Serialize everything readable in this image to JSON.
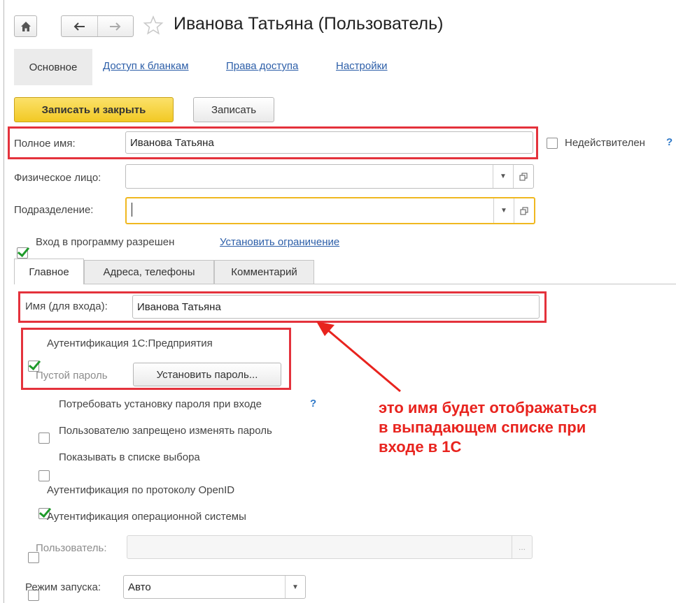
{
  "window": {
    "title": "Иванова Татьяна (Пользователь)",
    "icons": {
      "home": "home-icon",
      "back": "back-arrow-icon",
      "forward": "forward-arrow-icon",
      "favorite": "star-icon"
    }
  },
  "nav_tabs": [
    {
      "label": "Основное",
      "active": true
    },
    {
      "label": "Доступ к бланкам"
    },
    {
      "label": "Права доступа"
    },
    {
      "label": "Настройки"
    }
  ],
  "toolbar": {
    "save_close_label": "Записать и закрыть",
    "save_label": "Записать"
  },
  "form": {
    "full_name": {
      "label": "Полное имя:",
      "value": "Иванова Татьяна"
    },
    "invalid": {
      "label": "Недействителен",
      "checked": false,
      "help": "?"
    },
    "individual": {
      "label": "Физическое лицо:",
      "value": ""
    },
    "department": {
      "label": "Подразделение:",
      "value": ""
    },
    "login_allowed": {
      "label": "Вход в программу разрешен",
      "checked": true,
      "link": "Установить ограничение"
    }
  },
  "inner_tabs": [
    {
      "label": "Главное",
      "active": true
    },
    {
      "label": "Адреса, телефоны"
    },
    {
      "label": "Комментарий"
    }
  ],
  "main_tab": {
    "login_name": {
      "label": "Имя (для входа):",
      "value": "Иванова Татьяна"
    },
    "auth_1c": {
      "label": "Аутентификация 1С:Предприятия",
      "checked": true
    },
    "empty_password": "Пустой пароль",
    "set_password_button": "Установить пароль...",
    "require_password_change": {
      "label": "Потребовать установку пароля при входе",
      "checked": false,
      "help": "?"
    },
    "forbid_password_change": {
      "label": "Пользователю запрещено изменять пароль",
      "checked": false
    },
    "show_in_list": {
      "label": "Показывать в списке выбора",
      "checked": true
    },
    "auth_openid": {
      "label": "Аутентификация по протоколу OpenID",
      "checked": false
    },
    "auth_os": {
      "label": "Аутентификация операционной системы",
      "checked": false
    },
    "os_user": {
      "label": "Пользователь:",
      "value": "",
      "button": "..."
    },
    "launch_mode": {
      "label": "Режим запуска:",
      "value": "Авто"
    }
  },
  "annotation": {
    "text": "это имя будет отображаться\nв выпадающем списке при\nвходе в 1С",
    "color": "#e8231e"
  },
  "colors": {
    "accent_button": "#f7d43a",
    "highlight_border": "#f0b820",
    "link": "#2c5ea8",
    "annotation_box": "#e4323c",
    "checkmark": "#1e9a2a"
  }
}
